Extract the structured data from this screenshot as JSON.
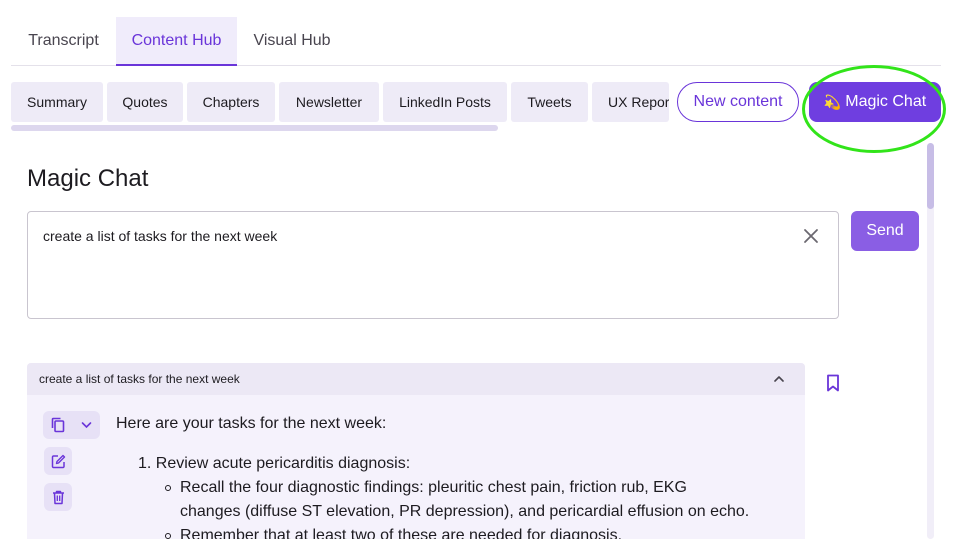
{
  "top_tabs": [
    {
      "label": "Transcript"
    },
    {
      "label": "Content Hub"
    },
    {
      "label": "Visual Hub"
    }
  ],
  "active_tab": "Content Hub",
  "chips": [
    "Summary",
    "Quotes",
    "Chapters",
    "Newsletter",
    "LinkedIn Posts",
    "Tweets",
    "UX Report"
  ],
  "actions": {
    "new_content": "New content",
    "magic_chat": "Magic Chat",
    "magic_icon": "💫"
  },
  "page_title": "Magic Chat",
  "prompt": {
    "value": "create a list of tasks for the next week",
    "send_label": "Send"
  },
  "response": {
    "query": "create a list of tasks for the next week",
    "intro": "Here are your tasks for the next week:",
    "item1": "1. Review acute pericarditis diagnosis:",
    "sub1_line1": "Recall the four diagnostic findings: pleuritic chest pain, friction rub, EKG",
    "sub1_line2": "changes (diffuse ST elevation, PR depression), and pericardial effusion on echo.",
    "sub2": "Remember that at least two of these are needed for diagnosis."
  },
  "colors": {
    "accent": "#6a35d9",
    "highlight_ring": "#32e41a",
    "send": "#8a5ee4"
  }
}
